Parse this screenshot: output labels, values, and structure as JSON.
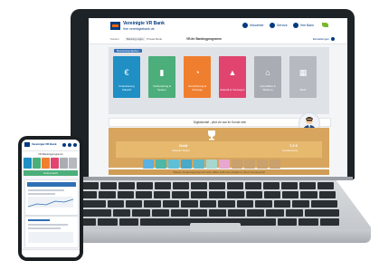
{
  "header": {
    "bank_name": "Vereinigte VR Bank",
    "bank_sub": "Ihre vereinigtebank.de",
    "links": [
      "Infocenter",
      "Service",
      "Ihre Bank"
    ]
  },
  "nav": {
    "tabs": [
      "Konten",
      "Banking-Apps",
      "Private Bank"
    ],
    "title": "VR-Ihr Bankingprogramm",
    "right_label": "Einstellungen"
  },
  "tiles": {
    "badge": "Bestandsaufgaben",
    "items": [
      {
        "label": "Finanzierung Zukunft",
        "color": "#1f8fc4",
        "icon": "euro-icon",
        "glyph": "€"
      },
      {
        "label": "Vorbereitung & Sparen",
        "color": "#4cae7a",
        "icon": "bar-chart-icon",
        "glyph": "▮"
      },
      {
        "label": "Versicherung & Vorsorge",
        "color": "#f07e2f",
        "icon": "pie-icon",
        "glyph": "◔"
      },
      {
        "label": "Zukunft & Vorsorgen",
        "color": "#e0446f",
        "icon": "person-icon",
        "glyph": "▲"
      },
      {
        "label": "Immobilien & Wohnen",
        "color": "#a9adb3",
        "icon": "house-icon",
        "glyph": "⌂"
      },
      {
        "label": "Mehr",
        "color": "#b6bac0",
        "icon": "grid-icon",
        "glyph": "▦"
      }
    ]
  },
  "digital": {
    "text": "Digitalschaft - jetzt vie war ihr Kunde sein"
  },
  "score": {
    "left_value": "Gold",
    "left_sub": "Aktueller Status",
    "right_value": "7,0 €",
    "right_sub": "Kundenvorteil"
  },
  "trophies": {
    "colors": [
      "#5bb1e2",
      "#4fb7a6",
      "#5fbfd6",
      "#4aa8c8",
      "#5fb8c9",
      "#a7d7cc",
      "#e7a7d0",
      "#c9a16d",
      "#c9a16d",
      "#c9a16d",
      "#c9a16d"
    ]
  },
  "panel_note": "Weitere Vergünstigungen für Gold, Silber & Bronze erhalten in Ihrem Kundenprofil",
  "phone": {
    "bank_name": "Vereinigte VR Bank",
    "title": "VR-Bankingprogramm",
    "tile_colors": [
      "#1f8fc4",
      "#4cae7a",
      "#f07e2f",
      "#e0446f",
      "#a9adb3",
      "#b6bac0"
    ],
    "green_bar": "Gold erreicht"
  }
}
